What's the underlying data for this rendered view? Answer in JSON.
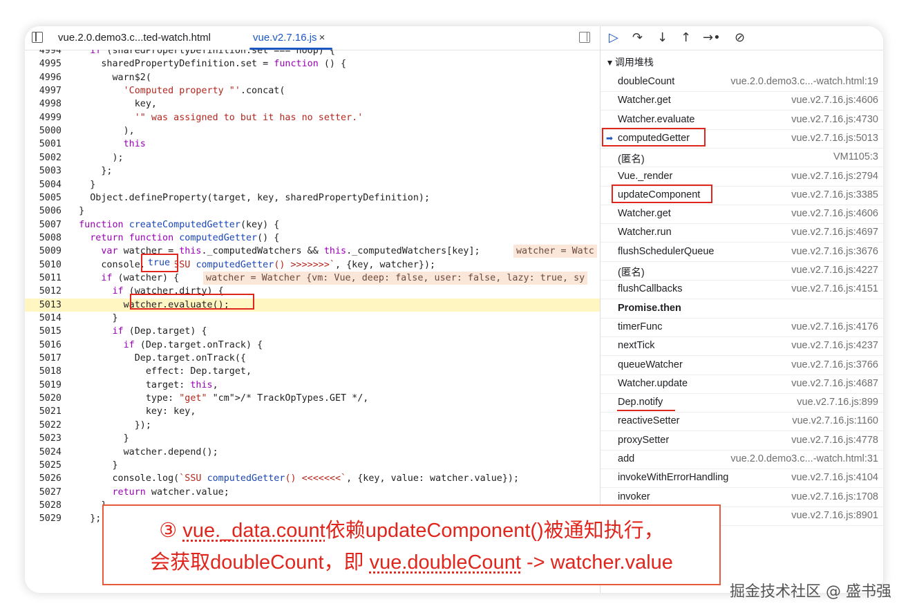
{
  "tabs": {
    "tab1": "vue.2.0.demo3.c...ted-watch.html",
    "tab2": "vue.v2.7.16.js",
    "close": "×"
  },
  "debugger": {
    "section_title": "▾ 调用堆栈",
    "controls": [
      "resume-icon",
      "step-over-icon",
      "step-into-icon",
      "step-out-icon",
      "step-icon",
      "deactivate-breakpoints-icon"
    ]
  },
  "code_lines": [
    {
      "n": "4994",
      "t": "    if (sharedPropertyDefinition.set === noop) {"
    },
    {
      "n": "4995",
      "t": "      sharedPropertyDefinition.set = function () {"
    },
    {
      "n": "4996",
      "t": "        warn$2("
    },
    {
      "n": "4997",
      "t": "          'Computed property \"'.concat("
    },
    {
      "n": "4998",
      "t": "            key,"
    },
    {
      "n": "4999",
      "t": "            '\" was assigned to but it has no setter.'"
    },
    {
      "n": "5000",
      "t": "          ),"
    },
    {
      "n": "5001",
      "t": "          this"
    },
    {
      "n": "5002",
      "t": "        );"
    },
    {
      "n": "5003",
      "t": "      };"
    },
    {
      "n": "5004",
      "t": "    }"
    },
    {
      "n": "5005",
      "t": "    Object.defineProperty(target, key, sharedPropertyDefinition);"
    },
    {
      "n": "5006",
      "t": "  }"
    },
    {
      "n": "5007",
      "t": "  function createComputedGetter(key) {"
    },
    {
      "n": "5008",
      "t": "    return function computedGetter() {"
    },
    {
      "n": "5009",
      "t": "      var watcher = this._computedWatchers && this._computedWatchers[key];  "
    },
    {
      "n": "5010",
      "t": "      console.log(`SSU computedGetter() >>>>>>>`, {key, watcher});"
    },
    {
      "n": "5011",
      "t": "      if (watcher) {  "
    },
    {
      "n": "5012",
      "t": "        if (watcher.dirty) {"
    },
    {
      "n": "5013",
      "t": "          watcher.evaluate();"
    },
    {
      "n": "5014",
      "t": "        }"
    },
    {
      "n": "5015",
      "t": "        if (Dep.target) {"
    },
    {
      "n": "5016",
      "t": "          if (Dep.target.onTrack) {"
    },
    {
      "n": "5017",
      "t": "            Dep.target.onTrack({"
    },
    {
      "n": "5018",
      "t": "              effect: Dep.target,"
    },
    {
      "n": "5019",
      "t": "              target: this,"
    },
    {
      "n": "5020",
      "t": "              type: \"get\" /* TrackOpTypes.GET */,"
    },
    {
      "n": "5021",
      "t": "              key: key,"
    },
    {
      "n": "5022",
      "t": "            });"
    },
    {
      "n": "5023",
      "t": "          }"
    },
    {
      "n": "5024",
      "t": "          watcher.depend();"
    },
    {
      "n": "5025",
      "t": "        }"
    },
    {
      "n": "5026",
      "t": "        console.log(`SSU computedGetter() <<<<<<<`, {key, value: watcher.value});"
    },
    {
      "n": "5027",
      "t": "        return watcher.value;"
    },
    {
      "n": "5028",
      "t": "      }"
    },
    {
      "n": "5029",
      "t": "    };"
    }
  ],
  "inline_values": {
    "l5009": "watcher = Watc",
    "l5011": "watcher = Watcher {vm: Vue, deep: false, user: false, lazy: true, sy",
    "hover_tooltip": "true"
  },
  "call_stack": [
    {
      "name": "doubleCount",
      "loc": "vue.2.0.demo3.c...-watch.html:19"
    },
    {
      "name": "Watcher.get",
      "loc": "vue.v2.7.16.js:4606"
    },
    {
      "name": "Watcher.evaluate",
      "loc": "vue.v2.7.16.js:4730"
    },
    {
      "name": "computedGetter",
      "loc": "vue.v2.7.16.js:5013"
    },
    {
      "name": "(匿名)",
      "loc": "VM1105:3"
    },
    {
      "name": "Vue._render",
      "loc": "vue.v2.7.16.js:2794"
    },
    {
      "name": "updateComponent",
      "loc": "vue.v2.7.16.js:3385"
    },
    {
      "name": "Watcher.get",
      "loc": "vue.v2.7.16.js:4606"
    },
    {
      "name": "Watcher.run",
      "loc": "vue.v2.7.16.js:4697"
    },
    {
      "name": "flushSchedulerQueue",
      "loc": "vue.v2.7.16.js:3676"
    },
    {
      "name": "(匿名)",
      "loc": "vue.v2.7.16.js:4227"
    },
    {
      "name": "flushCallbacks",
      "loc": "vue.v2.7.16.js:4151"
    },
    {
      "name": "Promise.then",
      "loc": ""
    },
    {
      "name": "timerFunc",
      "loc": "vue.v2.7.16.js:4176"
    },
    {
      "name": "nextTick",
      "loc": "vue.v2.7.16.js:4237"
    },
    {
      "name": "queueWatcher",
      "loc": "vue.v2.7.16.js:3766"
    },
    {
      "name": "Watcher.update",
      "loc": "vue.v2.7.16.js:4687"
    },
    {
      "name": "Dep.notify",
      "loc": "vue.v2.7.16.js:899"
    },
    {
      "name": "reactiveSetter",
      "loc": "vue.v2.7.16.js:1160"
    },
    {
      "name": "proxySetter",
      "loc": "vue.v2.7.16.js:4778"
    },
    {
      "name": "add",
      "loc": "vue.2.0.demo3.c...-watch.html:31"
    },
    {
      "name": "invokeWithErrorHandling",
      "loc": "vue.v2.7.16.js:4104"
    },
    {
      "name": "invoker",
      "loc": "vue.v2.7.16.js:1708"
    },
    {
      "name": "",
      "loc": "vue.v2.7.16.js:8901"
    }
  ],
  "callout": {
    "line1_prefix": "③ ",
    "line1_u": "vue._data.count",
    "line1_rest": "依赖updateComponent()被通知执行，",
    "line2_prefix": "会获取doubleCount，即 ",
    "line2_u": "vue.doubleCount",
    "line2_rest": " -> watcher.value"
  },
  "watermark": "掘金技术社区 @ 盛书强",
  "colors": {
    "accent": "#1a56c4",
    "annotation_red": "#e0251c",
    "highlight_line": "#fff6c2"
  }
}
